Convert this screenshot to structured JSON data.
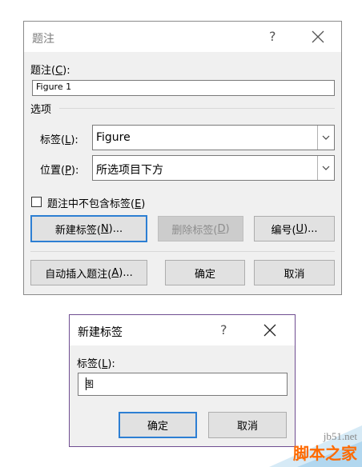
{
  "caption_dialog": {
    "title": "题注",
    "help": "?",
    "caption_label": "题注(",
    "caption_key": "C",
    "caption_suffix": "):",
    "caption_value": "Figure 1",
    "options_label": "选项",
    "label_label": "标签(",
    "label_key": "L",
    "label_suffix": "):",
    "label_value": "Figure",
    "position_label": "位置(",
    "position_key": "P",
    "position_suffix": "):",
    "position_value": "所选项目下方",
    "exclude_label": "题注中不包含标签(",
    "exclude_key": "E",
    "exclude_suffix": ")",
    "exclude_checked": false,
    "new_label_button": "新建标签(",
    "new_label_key": "N",
    "new_label_suffix": ")...",
    "delete_label_button": "删除标签(",
    "delete_label_key": "D",
    "delete_label_suffix": ")",
    "numbering_button": "编号(",
    "numbering_key": "U",
    "numbering_suffix": ")...",
    "autocaption_button": "自动插入题注(",
    "autocaption_key": "A",
    "autocaption_suffix": ")...",
    "ok_button": "确定",
    "cancel_button": "取消"
  },
  "new_label_dialog": {
    "title": "新建标签",
    "help": "?",
    "label_label": "标签(",
    "label_key": "L",
    "label_suffix": "):",
    "label_value": "图",
    "ok_button": "确定",
    "cancel_button": "取消"
  },
  "watermark": {
    "site": "jb51.net",
    "name": "脚本之家"
  },
  "colors": {
    "dialog_bg": "#f0f0f0",
    "default_button_border": "#2d7fd3",
    "active_dialog_border": "#6f4d91",
    "watermark_accent": "#ff6a00"
  }
}
